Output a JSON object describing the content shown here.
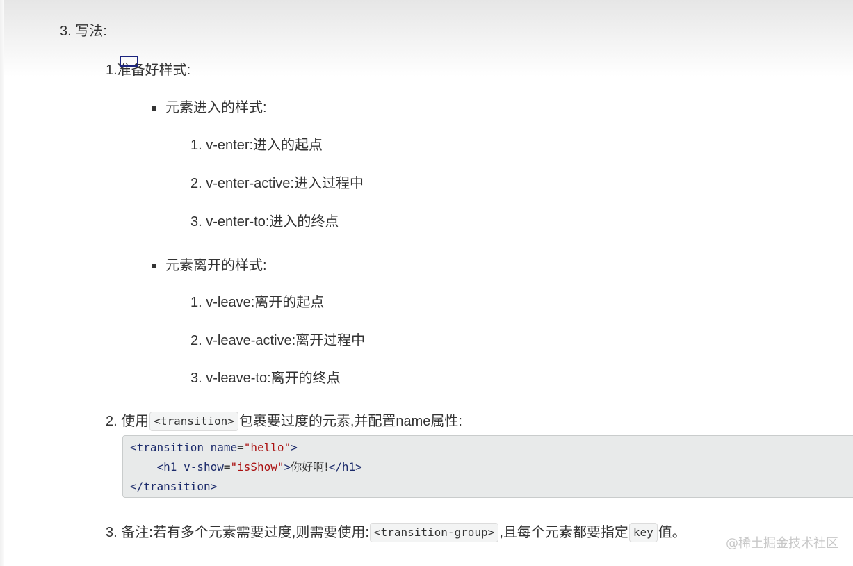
{
  "section": {
    "number": "3.",
    "title": "写法:"
  },
  "steps": [
    {
      "number": "1.",
      "text": "准备好样式:",
      "groups": [
        {
          "label": "元素进入的样式:",
          "items": [
            {
              "number": "1.",
              "text": "v-enter:进入的起点"
            },
            {
              "number": "2.",
              "text": "v-enter-active:进入过程中"
            },
            {
              "number": "3.",
              "text": "v-enter-to:进入的终点"
            }
          ]
        },
        {
          "label": "元素离开的样式:",
          "items": [
            {
              "number": "1.",
              "text": "v-leave:离开的起点"
            },
            {
              "number": "2.",
              "text": "v-leave-active:离开过程中"
            },
            {
              "number": "3.",
              "text": "v-leave-to:离开的终点"
            }
          ]
        }
      ]
    },
    {
      "number": "2.",
      "before": "使用",
      "code": "<transition>",
      "after": "包裹要过度的元素,并配置name属性:"
    },
    {
      "number": "3.",
      "before": "备注:若有多个元素需要过度,则需要使用:",
      "code": "<transition-group>",
      "middle": ",且每个元素都要指定",
      "code2": "key",
      "after": "值。"
    }
  ],
  "code_block": {
    "line1_open": "<transition ",
    "line1_attr": "name",
    "line1_eq": "=",
    "line1_val": "\"hello\"",
    "line1_close": ">",
    "line2_indent": "    ",
    "line2_open": "<h1 ",
    "line2_attr": "v-show",
    "line2_eq": "=",
    "line2_val": "\"isShow\"",
    "line2_gt": ">",
    "line2_text": "你好啊!",
    "line2_close": "</h1>",
    "line3": "</transition>"
  },
  "watermark": "@稀土掘金技术社区"
}
